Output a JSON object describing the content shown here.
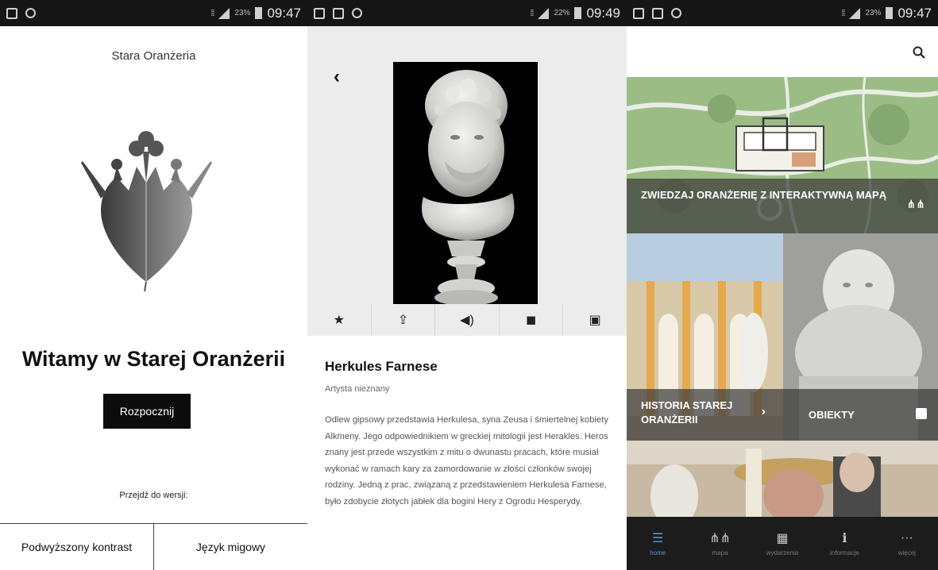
{
  "screen1": {
    "status": {
      "time": "09:47",
      "battery": "23%"
    },
    "app_title": "Stara Oranżeria",
    "welcome": "Witamy w Starej Oranżerii",
    "start_button": "Rozpocznij",
    "goto_label": "Przejdź do wersji:",
    "options": [
      "Podwyższony kontrast",
      "Język migowy"
    ]
  },
  "screen2": {
    "status": {
      "time": "09:49",
      "battery": "22%"
    },
    "title": "Herkules Farnese",
    "artist": "Artysta nieznany",
    "description": "Odlew gipsowy przedstawia Herkulesa, syna Zeusa i śmiertelnej kobiety Alkmeny. Jego odpowiednikiem w greckiej mitologii jest Herakles. Heros znany jest przede wszystkim z mitu o dwunastu pracach, które musiał wykonać w ramach kary za zamordowanie w złości członków swojej rodziny. Jedną z prac, związaną z przedstawieniem Herkulesa Farnese, było zdobycie złotych jabłek dla bogini Hery z Ogrodu Hesperydy.",
    "actions": [
      "star-icon",
      "share-icon",
      "audio-icon",
      "video-icon",
      "gallery-icon"
    ]
  },
  "screen3": {
    "status": {
      "time": "09:47",
      "battery": "23%"
    },
    "tiles": {
      "map": "ZWIEDZAJ ORANŻERIĘ Z INTERAKTYWNĄ MAPĄ",
      "history": "HISTORIA STAREJ ORANŻERII",
      "objects": "OBIEKTY"
    },
    "nav": [
      {
        "label": "home",
        "icon": "menu-icon"
      },
      {
        "label": "mapa",
        "icon": "map-icon"
      },
      {
        "label": "wydarzenia",
        "icon": "events-icon"
      },
      {
        "label": "informacje",
        "icon": "info-icon"
      },
      {
        "label": "więcej",
        "icon": "more-icon"
      }
    ]
  },
  "colors": {
    "accent": "#5b8fcb",
    "statusbar": "#161616",
    "navbar": "#1c1c1c"
  }
}
